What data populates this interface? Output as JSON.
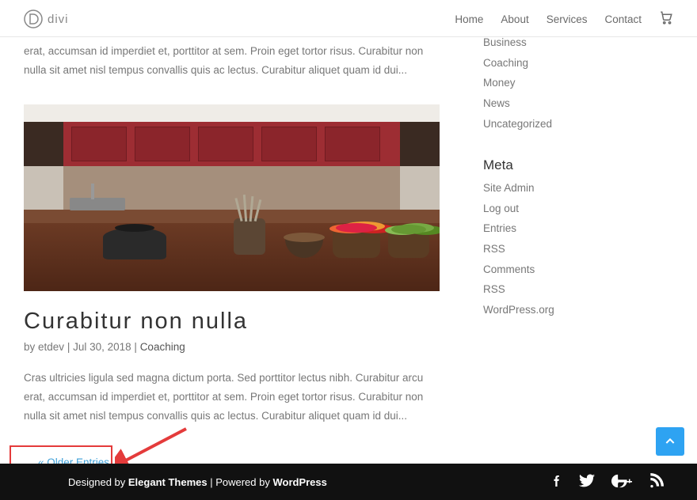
{
  "brand": "divi",
  "nav": [
    "Home",
    "About",
    "Services",
    "Contact"
  ],
  "top_excerpt": "erat, accumsan id imperdiet et, porttitor at sem. Proin eget tortor risus. Curabitur non nulla sit amet nisl tempus convallis quis ac lectus. Curabitur aliquet quam id dui...",
  "post": {
    "title": "Curabitur non nulla",
    "by": "by",
    "author": "etdev",
    "date": "Jul 30, 2018",
    "category": "Coaching",
    "excerpt": "Cras ultricies ligula sed magna dictum porta. Sed porttitor lectus nibh. Curabitur arcu erat, accumsan id imperdiet et, porttitor at sem. Proin eget tortor risus. Curabitur non nulla sit amet nisl tempus convallis quis ac lectus. Curabitur aliquet quam id dui..."
  },
  "pagination": {
    "older": "« Older Entries"
  },
  "sidebar": {
    "top_cut_item": "Business",
    "categories": [
      "Coaching",
      "Money",
      "News",
      "Uncategorized"
    ],
    "meta_heading": "Meta",
    "meta": [
      {
        "label": "Site Admin"
      },
      {
        "label": "Log out"
      },
      {
        "label": "Entries ",
        "abbr": "RSS"
      },
      {
        "label": "Comments ",
        "abbr": "RSS"
      },
      {
        "label": "WordPress.org"
      }
    ]
  },
  "footer": {
    "designed_by": "Designed by ",
    "theme": "Elegant Themes",
    "sep": " | ",
    "powered_by": "Powered by ",
    "platform": "WordPress"
  }
}
